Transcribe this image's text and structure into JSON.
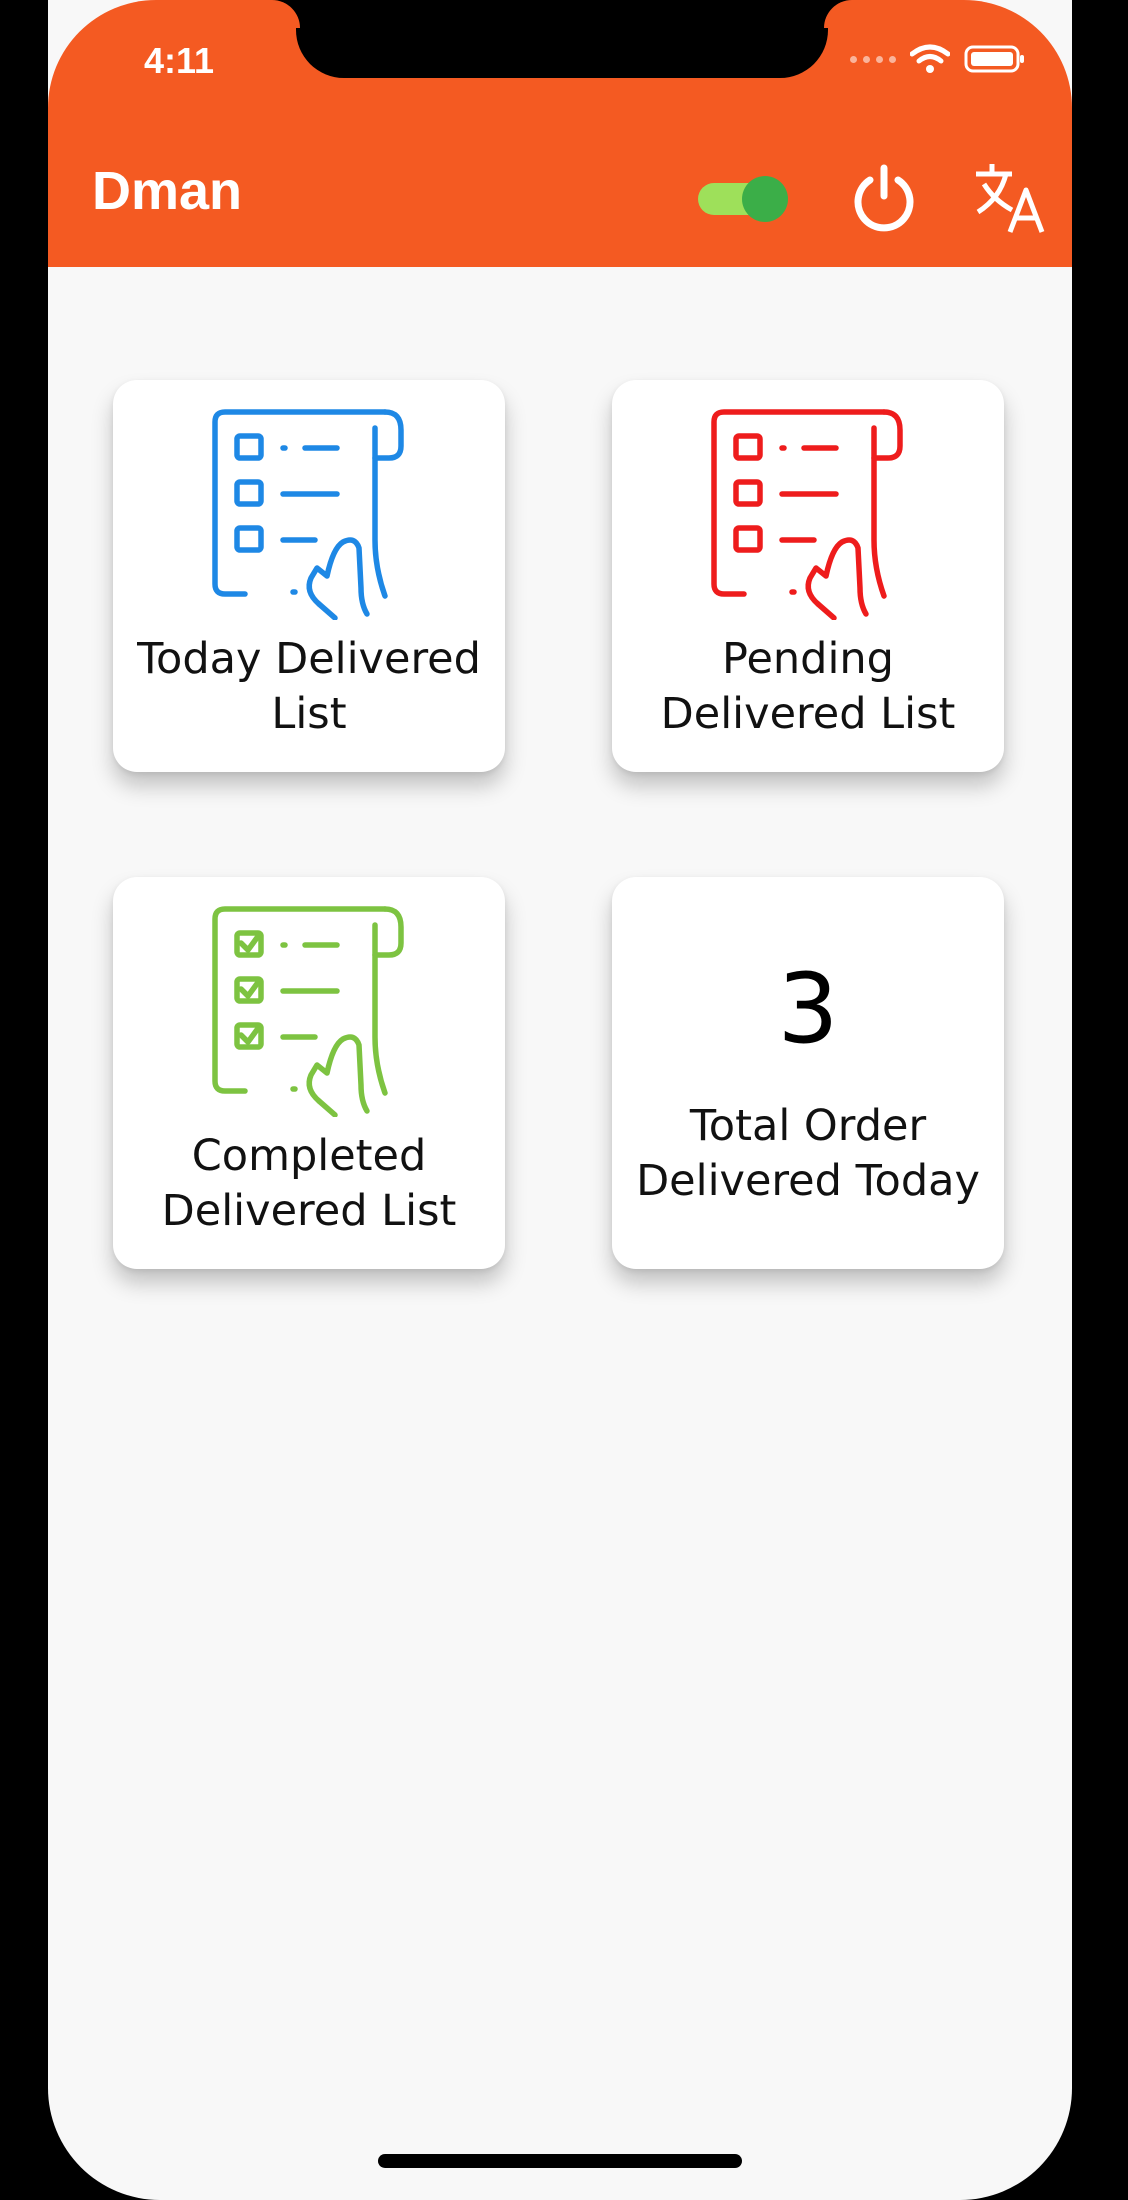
{
  "status_bar": {
    "time": "4:11"
  },
  "app_bar": {
    "title": "Dman",
    "online_toggle_on": true,
    "icons": [
      "power-icon",
      "translate-icon"
    ]
  },
  "colors": {
    "primary": "#f45a22",
    "today_icon": "#1e88e5",
    "pending_icon": "#ee1c1c",
    "completed_icon": "#7dc341",
    "toggle_track": "#9ee05a",
    "toggle_thumb": "#3bae48"
  },
  "cards": [
    {
      "label": "Today Delivered\nList",
      "icon": "list-hand-icon"
    },
    {
      "label": "Pending\nDelivered List",
      "icon": "list-hand-icon"
    },
    {
      "label": "Completed\nDelivered List",
      "icon": "checklist-hand-icon"
    },
    {
      "number": "3",
      "label": "Total Order\nDelivered Today"
    }
  ]
}
